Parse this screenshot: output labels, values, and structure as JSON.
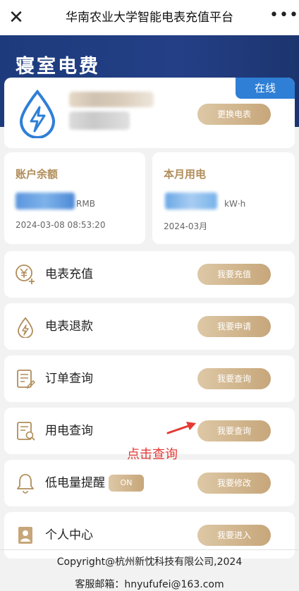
{
  "topbar": {
    "close_icon": "close-icon",
    "title": "华南农业大学智能电表充值平台",
    "more_icon": "more-icon"
  },
  "hero": {
    "title": "寝室电费"
  },
  "meter": {
    "status": "在线",
    "change_button": "更换电表",
    "icon": "lightning-drop-icon",
    "accent": "#2f7fd6"
  },
  "balance": {
    "label": "账户余额",
    "unit": "RMB",
    "time": "2024-03-08 08:53:20"
  },
  "usage": {
    "label": "本月用电",
    "unit": "kW·h",
    "time": "2024-03月"
  },
  "menu": [
    {
      "label": "电表充值",
      "button": "我要充值",
      "icon": "yuan-plus-icon"
    },
    {
      "label": "电表退款",
      "button": "我要申请",
      "icon": "refund-drop-icon"
    },
    {
      "label": "订单查询",
      "button": "我要查询",
      "icon": "order-doc-icon"
    },
    {
      "label": "用电查询",
      "button": "我要查询",
      "icon": "usage-search-icon"
    },
    {
      "label": "低电量提醒",
      "button": "我要修改",
      "icon": "bell-icon",
      "toggle": "ON"
    },
    {
      "label": "个人中心",
      "button": "我要进入",
      "icon": "person-icon"
    }
  ],
  "annotation": {
    "text": "点击查询",
    "color": "#e53935"
  },
  "footer": {
    "copyright": "Copyright@杭州新忱科技有限公司,2024",
    "email": "客服邮箱：hnyufufei@163.com"
  },
  "colors": {
    "gold": "#c7a67a",
    "hero_blue": "#1d3b7c",
    "label_gold": "#b08d5a"
  }
}
